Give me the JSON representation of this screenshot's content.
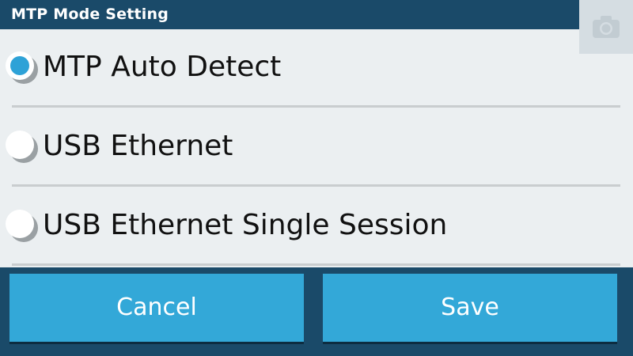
{
  "title_bar": {
    "title": "MTP Mode Setting",
    "camera_icon": "camera-icon"
  },
  "options": [
    {
      "label": "MTP Auto Detect",
      "selected": true
    },
    {
      "label": "USB Ethernet",
      "selected": false
    },
    {
      "label": "USB Ethernet Single Session",
      "selected": false
    }
  ],
  "buttons": {
    "cancel_label": "Cancel",
    "save_label": "Save"
  },
  "colors": {
    "title_bar": "#1a4a69",
    "background": "#ebeff1",
    "accent": "#33a8d8",
    "radio_selected": "#2ea2d7"
  }
}
